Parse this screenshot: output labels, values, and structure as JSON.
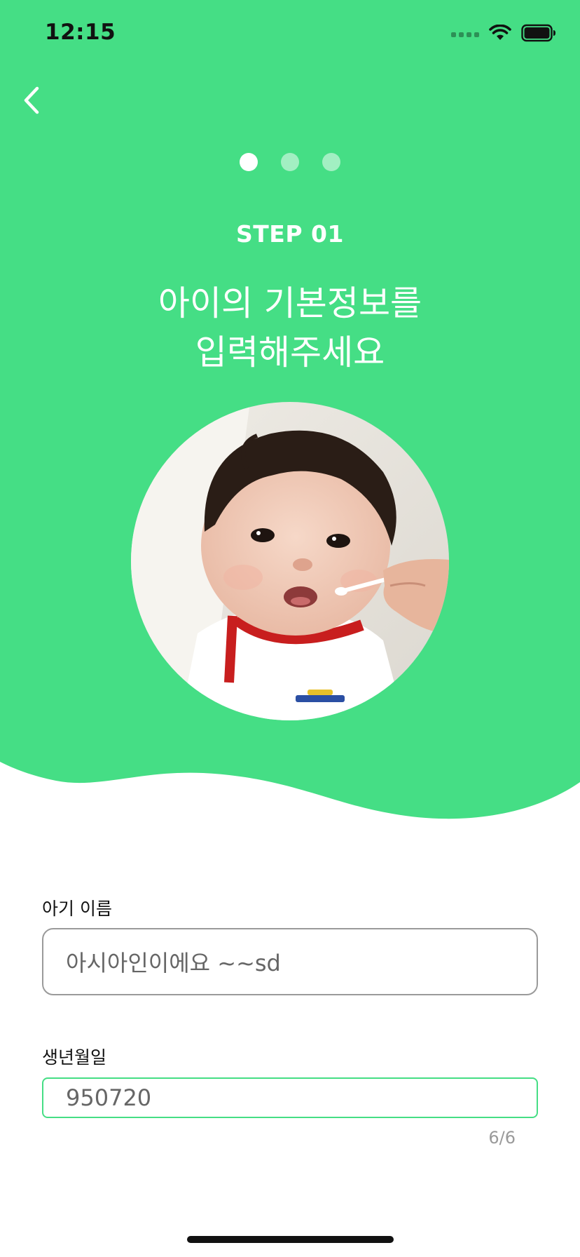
{
  "status_bar": {
    "time": "12:15",
    "icons": [
      "signal-icon",
      "wifi-icon",
      "battery-icon"
    ]
  },
  "colors": {
    "brand_green": "#45de85",
    "focus_border": "#45de85",
    "default_border": "#9a9a9a"
  },
  "header": {
    "back_icon": "chevron-left-icon",
    "pager": {
      "total": 3,
      "active_index": 0
    },
    "step_label": "STEP 01",
    "headline_line1": "아이의 기본정보를",
    "headline_line2": "입력해주세요"
  },
  "form": {
    "baby_name": {
      "label": "아기 이름",
      "value": "아시아인이에요 ~~sd"
    },
    "birth_date": {
      "label": "생년월일",
      "value": "950720",
      "counter": "6/6"
    }
  }
}
